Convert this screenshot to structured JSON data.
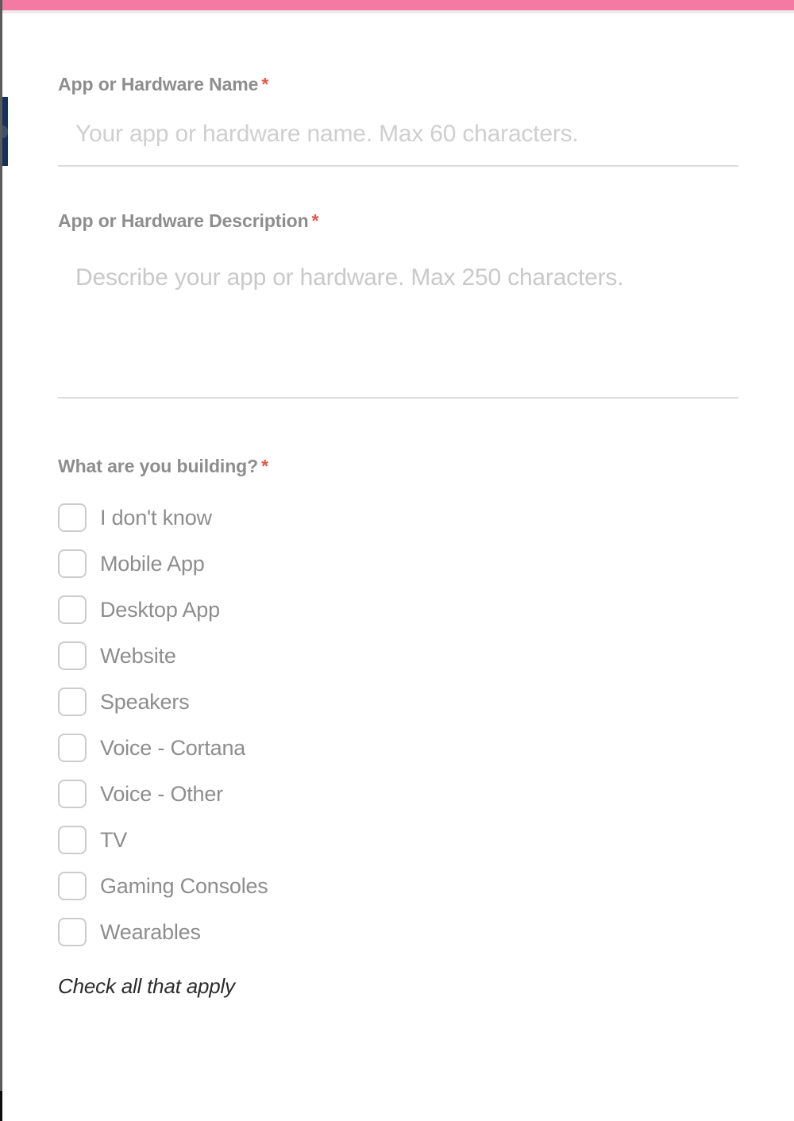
{
  "theme": {
    "accent_pink": "#F47AA3",
    "required_asterisk": "#E8544A",
    "label_gray": "#8D8D8D",
    "placeholder_gray": "#CFCFCF",
    "sidebar_navy": "#16325C"
  },
  "fields": {
    "name": {
      "label": "App or Hardware Name",
      "required_marker": "*",
      "value": "",
      "placeholder": "Your app or hardware name. Max 60 characters."
    },
    "description": {
      "label": "App or Hardware Description",
      "required_marker": "*",
      "value": "",
      "placeholder": "Describe your app or hardware. Max 250 characters."
    }
  },
  "building_group": {
    "label": "What are you building?",
    "required_marker": "*",
    "helper": "Check all that apply",
    "options": [
      {
        "label": "I don't know",
        "checked": false
      },
      {
        "label": "Mobile App",
        "checked": false
      },
      {
        "label": "Desktop App",
        "checked": false
      },
      {
        "label": "Website",
        "checked": false
      },
      {
        "label": "Speakers",
        "checked": false
      },
      {
        "label": "Voice - Cortana",
        "checked": false
      },
      {
        "label": "Voice - Other",
        "checked": false
      },
      {
        "label": "TV",
        "checked": false
      },
      {
        "label": "Gaming Consoles",
        "checked": false
      },
      {
        "label": "Wearables",
        "checked": false
      }
    ]
  }
}
